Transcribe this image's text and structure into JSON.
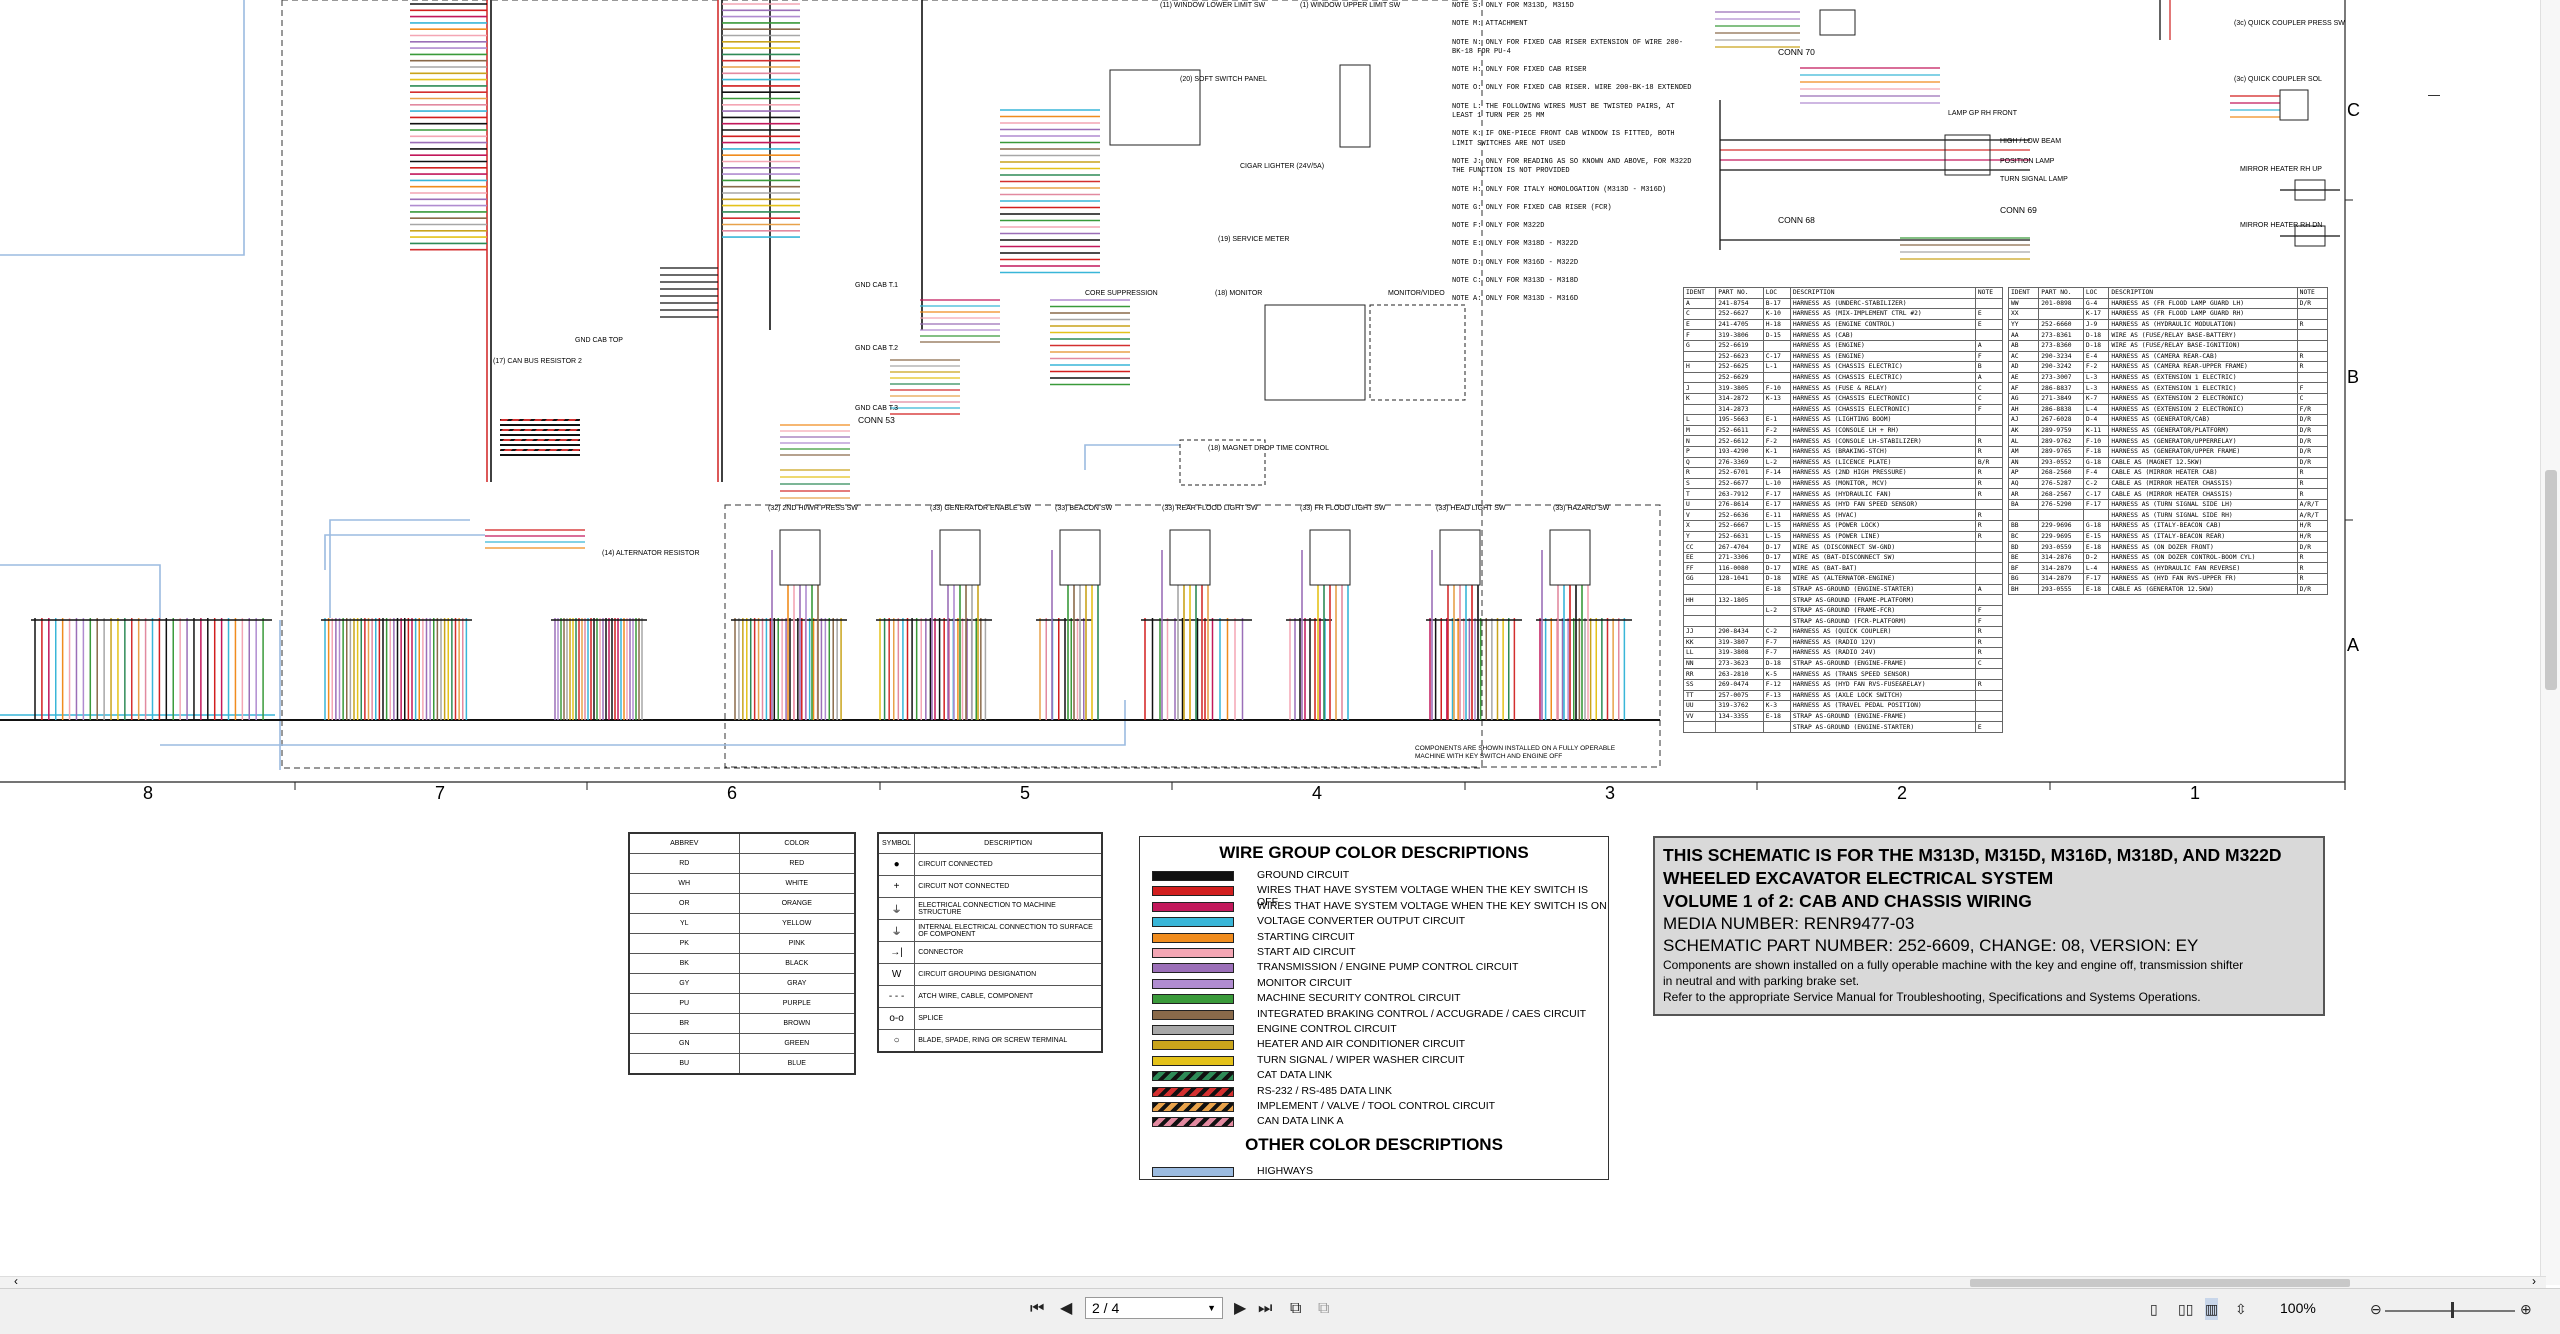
{
  "viewer": {
    "page_value": "2 / 4",
    "zoom": "100%",
    "icons": [
      "first-page-icon",
      "prev-page-icon",
      "next-page-icon",
      "last-page-icon",
      "fit-page-icon",
      "fit-width-icon",
      "single-page-icon",
      "two-page-icon",
      "continuous-icon",
      "scroll-icon",
      "zoom-out-icon",
      "zoom-in-icon"
    ]
  },
  "grid": {
    "rows": [
      "C",
      "B",
      "A"
    ],
    "columns": [
      "8",
      "7",
      "6",
      "5",
      "4",
      "3",
      "2",
      "1"
    ]
  },
  "schematic_labels": {
    "conn70": "CONN 70",
    "conn68": "CONN 68",
    "conn69": "CONN 69",
    "conn53": "CONN 53",
    "c-coupler": "(3c) QUICK COUPLER PRESS SW",
    "c-coupler2": "(3c) QUICK COUPLER SOL",
    "mirror-heater-up": "MIRROR HEATER RH UP",
    "mirror-heater-dn": "MIRROR HEATER RH DN",
    "lamp-rh": "LAMP GP RH FRONT",
    "high-low": "HIGH / LOW BEAM",
    "position-lamp": "POSITION LAMP",
    "turn-signal": "TURN SIGNAL LAMP",
    "soft-switch": "(20) SOFT SWITCH PANEL",
    "monitor": "(18) MONITOR",
    "monitor-video": "MONITOR/VIDEO",
    "cigar-lighter": "CIGAR LIGHTER (24V/5A)",
    "service-meter": "(19) SERVICE METER",
    "core-suppression": "CORE SUPPRESSION",
    "can-bus-resistor": "(17) CAN BUS RESISTOR 2",
    "alternator-resistor": "(14) ALTERNATOR RESISTOR",
    "magnet-drop": "(18) MAGNET DROP TIME CONTROL",
    "window-lower": "(11) WINDOW LOWER LIMIT SW",
    "window-upper": "(1) WINDOW UPPER LIMIT SW",
    "gnd-cab-top": "GND CAB TOP",
    "gnd-cab-1": "GND CAB T.1",
    "gnd-cab-2": "GND CAB T.2",
    "gnd-cab-3": "GND CAB T.3",
    "sw-hiwr": "(32) 2ND HI/WR PRESS SW",
    "sw-gen": "(33) GENERATOR ENABLE SW",
    "sw-beacon": "(33) BEACON SW",
    "sw-rear-flood": "(33) REAR FLOOD LIGHT SW",
    "sw-fr-flood": "(33) FR FLOOD LIGHT SW",
    "sw-head": "(33) HEAD LIGHT SW",
    "sw-hazard": "(33) HAZARD SW",
    "components-note": "COMPONENTS ARE SHOWN INSTALLED ON A FULLY OPERABLE MACHINE WITH KEY SWITCH AND ENGINE OFF",
    "notes": [
      "NOTE S: ONLY FOR M313D, M315D",
      "NOTE M: ATTACHMENT",
      "NOTE N: ONLY FOR FIXED CAB RISER EXTENSION OF WIRE 200-BK-18 FOR PU-4",
      "NOTE H: ONLY FOR FIXED CAB RISER",
      "NOTE O: ONLY FOR FIXED CAB RISER. WIRE 200-BK-18 EXTENDED",
      "NOTE L: THE FOLLOWING WIRES MUST BE TWISTED PAIRS, AT LEAST 1 TURN PER 25 MM",
      "NOTE K: IF ONE-PIECE FRONT CAB WINDOW IS FITTED, BOTH LIMIT SWITCHES ARE NOT USED",
      "NOTE J: ONLY FOR READING AS SO KNOWN AND ABOVE, FOR M322D THE FUNCTION IS NOT PROVIDED",
      "NOTE H: ONLY FOR ITALY HOMOLOGATION (M313D - M316D)",
      "NOTE G: ONLY FOR FIXED CAB RISER (FCR)",
      "NOTE F: ONLY FOR M322D",
      "NOTE E: ONLY FOR M318D - M322D",
      "NOTE D: ONLY FOR M316D - M322D",
      "NOTE C: ONLY FOR M313D - M318D",
      "NOTE A: ONLY FOR M313D - M316D"
    ]
  },
  "abbrev_table": {
    "headers": [
      "ABBREV",
      "COLOR"
    ],
    "rows": [
      [
        "RD",
        "RED"
      ],
      [
        "WH",
        "WHITE"
      ],
      [
        "OR",
        "ORANGE"
      ],
      [
        "YL",
        "YELLOW"
      ],
      [
        "PK",
        "PINK"
      ],
      [
        "BK",
        "BLACK"
      ],
      [
        "GY",
        "GRAY"
      ],
      [
        "PU",
        "PURPLE"
      ],
      [
        "BR",
        "BROWN"
      ],
      [
        "GN",
        "GREEN"
      ],
      [
        "BU",
        "BLUE"
      ]
    ]
  },
  "symbol_table": {
    "headers": [
      "SYMBOL",
      "DESCRIPTION"
    ],
    "rows": [
      [
        "●",
        "CIRCUIT CONNECTED"
      ],
      [
        "+",
        "CIRCUIT NOT CONNECTED"
      ],
      [
        "⏚",
        "ELECTRICAL CONNECTION TO MACHINE STRUCTURE"
      ],
      [
        "⏚",
        "INTERNAL ELECTRICAL CONNECTION TO SURFACE OF COMPONENT"
      ],
      [
        "→|",
        "CONNECTOR"
      ],
      [
        "W",
        "CIRCUIT GROUPING DESIGNATION"
      ],
      [
        "- - -",
        "ATCH WIRE, CABLE, COMPONENT"
      ],
      [
        "o-o",
        "SPLICE"
      ],
      [
        "○",
        "BLADE, SPADE, RING OR SCREW TERMINAL"
      ]
    ]
  },
  "wire_group": {
    "title": "WIRE GROUP COLOR DESCRIPTIONS",
    "other_title": "OTHER COLOR DESCRIPTIONS",
    "items": [
      {
        "color": "#111111",
        "pattern": "solid",
        "label": "GROUND CIRCUIT"
      },
      {
        "color": "#d21f1f",
        "pattern": "solid",
        "label": "WIRES THAT HAVE SYSTEM VOLTAGE WHEN THE KEY SWITCH IS OFF"
      },
      {
        "color": "#c2185b",
        "pattern": "solid",
        "label": "WIRES THAT HAVE SYSTEM VOLTAGE WHEN THE KEY SWITCH IS ON"
      },
      {
        "color": "#39b6d8",
        "pattern": "solid",
        "label": "VOLTAGE CONVERTER OUTPUT CIRCUIT"
      },
      {
        "color": "#f08c1e",
        "pattern": "solid",
        "label": "STARTING CIRCUIT"
      },
      {
        "color": "#f4a6b4",
        "pattern": "solid",
        "label": "START AID CIRCUIT"
      },
      {
        "color": "#9b6fb8",
        "pattern": "solid",
        "label": "TRANSMISSION / ENGINE PUMP CONTROL CIRCUIT"
      },
      {
        "color": "#b08cd0",
        "pattern": "solid",
        "label": "MONITOR CIRCUIT"
      },
      {
        "color": "#3a9a3a",
        "pattern": "solid",
        "label": "MACHINE SECURITY CONTROL CIRCUIT"
      },
      {
        "color": "#8a6a4a",
        "pattern": "solid",
        "label": "INTEGRATED BRAKING CONTROL / ACCUGRADE / CAES CIRCUIT"
      },
      {
        "color": "#a7a7a7",
        "pattern": "solid",
        "label": "ENGINE CONTROL CIRCUIT"
      },
      {
        "color": "#c9a41c",
        "pattern": "solid",
        "label": "HEATER AND AIR CONDITIONER CIRCUIT"
      },
      {
        "color": "#e4c21a",
        "pattern": "solid",
        "label": "TURN SIGNAL / WIPER WASHER CIRCUIT"
      },
      {
        "color": "#2e8b57",
        "pattern": "hatch",
        "label": "CAT DATA LINK"
      },
      {
        "color": "#d32f2f",
        "pattern": "hatch",
        "label": "RS-232 / RS-485 DATA LINK"
      },
      {
        "color": "#e8a24a",
        "pattern": "hatch",
        "label": "IMPLEMENT / VALVE / TOOL CONTROL CIRCUIT"
      },
      {
        "color": "#e28aa0",
        "pattern": "hatch",
        "label": "CAN DATA LINK A"
      }
    ],
    "other_items": [
      {
        "color": "#9bbbe0",
        "pattern": "solid",
        "label": "HIGHWAYS"
      }
    ]
  },
  "info_box": {
    "title1": "THIS SCHEMATIC IS FOR THE M313D, M315D, M316D, M318D, AND M322D",
    "title2": "WHEELED EXCAVATOR ELECTRICAL SYSTEM",
    "title3": "VOLUME 1 of 2: CAB AND CHASSIS WIRING",
    "media": "MEDIA NUMBER: RENR9477-03",
    "part": "SCHEMATIC PART NUMBER: 252-6609, CHANGE: 08, VERSION: EY",
    "desc1": "Components are shown installed on a fully operable machine with the key and engine off, transmission shifter",
    "desc2": "in neutral and with parking brake set.",
    "desc3": "Refer to the appropriate Service Manual for Troubleshooting, Specifications and Systems Operations."
  },
  "parts_left": {
    "headers": [
      "IDENT",
      "PART NO.",
      "LOC",
      "DESCRIPTION",
      "NOTE"
    ],
    "rows": [
      [
        "A",
        "241-8754",
        "B-17",
        "HARNESS AS (UNDERC-STABILIZER)",
        ""
      ],
      [
        "C",
        "252-6627",
        "K-10",
        "HARNESS AS (MIX-IMPLEMENT CTRL #2)",
        "E"
      ],
      [
        "E",
        "241-4705",
        "H-18",
        "HARNESS AS (ENGINE CONTROL)",
        "E"
      ],
      [
        "F",
        "319-3806",
        "D-15",
        "HARNESS AS (CAB)",
        ""
      ],
      [
        "G",
        "252-6619",
        "",
        "HARNESS AS (ENGINE)",
        "A"
      ],
      [
        "",
        "252-6623",
        "C-17",
        "HARNESS AS (ENGINE)",
        "F"
      ],
      [
        "H",
        "252-6625",
        "L-1",
        "HARNESS AS (CHASSIS ELECTRIC)",
        "B"
      ],
      [
        "",
        "252-6629",
        "",
        "HARNESS AS (CHASSIS ELECTRIC)",
        "A"
      ],
      [
        "J",
        "319-3805",
        "F-10",
        "HARNESS AS (FUSE & RELAY)",
        "C"
      ],
      [
        "K",
        "314-2872",
        "K-13",
        "HARNESS AS (CHASSIS ELECTRONIC)",
        "C"
      ],
      [
        "",
        "314-2873",
        "",
        "HARNESS AS (CHASSIS ELECTRONIC)",
        "F"
      ],
      [
        "L",
        "195-5663",
        "E-1",
        "HARNESS AS (LIGHTING BOOM)",
        ""
      ],
      [
        "M",
        "252-6611",
        "F-2",
        "HARNESS AS (CONSOLE LH + RH)",
        ""
      ],
      [
        "N",
        "252-6612",
        "F-2",
        "HARNESS AS (CONSOLE LH-STABILIZER)",
        "R"
      ],
      [
        "P",
        "193-4290",
        "K-1",
        "HARNESS AS (BRAKING-STCH)",
        "R"
      ],
      [
        "Q",
        "276-3369",
        "L-2",
        "HARNESS AS (LICENCE PLATE)",
        "B/R"
      ],
      [
        "R",
        "252-6701",
        "F-14",
        "HARNESS AS (2ND HIGH PRESSURE)",
        "R"
      ],
      [
        "S",
        "252-6677",
        "L-10",
        "HARNESS AS (MONITOR, MCV)",
        "R"
      ],
      [
        "T",
        "263-7912",
        "F-17",
        "HARNESS AS (HYDRAULIC FAN)",
        "R"
      ],
      [
        "U",
        "276-8614",
        "E-17",
        "HARNESS AS (HYD FAN SPEED SENSOR)",
        ""
      ],
      [
        "V",
        "252-6636",
        "E-11",
        "HARNESS AS (HVAC)",
        "R"
      ],
      [
        "X",
        "252-6667",
        "L-15",
        "HARNESS AS (POWER LOCK)",
        "R"
      ],
      [
        "Y",
        "252-6631",
        "L-15",
        "HARNESS AS (POWER LINE)",
        "R"
      ],
      [
        "CC",
        "267-4704",
        "D-17",
        "WIRE AS (DISCONNECT SW-GND)",
        ""
      ],
      [
        "EE",
        "271-3306",
        "D-17",
        "WIRE AS (BAT-DISCONNECT SW)",
        ""
      ],
      [
        "FF",
        "116-0080",
        "D-17",
        "WIRE AS (BAT-BAT)",
        ""
      ],
      [
        "GG",
        "128-1041",
        "D-18",
        "WIRE AS (ALTERNATOR-ENGINE)",
        ""
      ],
      [
        "",
        "",
        "E-18",
        "STRAP AS-GROUND (ENGINE-STARTER)",
        "A"
      ],
      [
        "HH",
        "132-1805",
        "",
        "STRAP AS-GROUND (FRAME-PLATFORM)",
        ""
      ],
      [
        "",
        "",
        "L-2",
        "STRAP AS-GROUND (FRAME-FCR)",
        "F"
      ],
      [
        "",
        "",
        "",
        "STRAP AS-GROUND (FCR-PLATFORM)",
        "F"
      ],
      [
        "JJ",
        "290-8434",
        "C-2",
        "HARNESS AS (QUICK COUPLER)",
        "R"
      ],
      [
        "KK",
        "319-3807",
        "F-7",
        "HARNESS AS (RADIO 12V)",
        "R"
      ],
      [
        "LL",
        "319-3808",
        "F-7",
        "HARNESS AS (RADIO 24V)",
        "R"
      ],
      [
        "NN",
        "273-3623",
        "D-18",
        "STRAP AS-GROUND (ENGINE-FRAME)",
        "C"
      ],
      [
        "RR",
        "263-2810",
        "K-5",
        "HARNESS AS (TRANS SPEED SENSOR)",
        ""
      ],
      [
        "SS",
        "269-0474",
        "F-12",
        "HARNESS AS (HYD FAN RVS-FUSE&RELAY)",
        "R"
      ],
      [
        "TT",
        "257-0075",
        "F-13",
        "HARNESS AS (AXLE LOCK SWITCH)",
        ""
      ],
      [
        "UU",
        "319-3762",
        "K-3",
        "HARNESS AS (TRAVEL PEDAL POSITION)",
        ""
      ],
      [
        "VV",
        "134-3355",
        "E-18",
        "STRAP AS-GROUND (ENGINE-FRAME)",
        ""
      ],
      [
        "",
        "",
        "",
        "STRAP AS-GROUND (ENGINE-STARTER)",
        "E"
      ]
    ]
  },
  "parts_right": {
    "headers": [
      "IDENT",
      "PART NO.",
      "LOC",
      "DESCRIPTION",
      "NOTE"
    ],
    "rows": [
      [
        "WW",
        "201-0898",
        "G-4",
        "HARNESS AS (FR FLOOD LAMP GUARD LH)",
        "D/R"
      ],
      [
        "XX",
        "",
        "K-17",
        "HARNESS AS (FR FLOOD LAMP GUARD RH)",
        ""
      ],
      [
        "YY",
        "252-6660",
        "J-9",
        "HARNESS AS (HYDRAULIC MODULATION)",
        "R"
      ],
      [
        "AA",
        "273-8361",
        "D-18",
        "WIRE AS (FUSE/RELAY BASE-BATTERY)",
        ""
      ],
      [
        "AB",
        "273-8360",
        "D-18",
        "WIRE AS (FUSE/RELAY BASE-IGNITION)",
        ""
      ],
      [
        "AC",
        "290-3234",
        "E-4",
        "HARNESS AS (CAMERA REAR-CAB)",
        "R"
      ],
      [
        "AD",
        "290-3242",
        "F-2",
        "HARNESS AS (CAMERA REAR-UPPER FRAME)",
        "R"
      ],
      [
        "AE",
        "273-3007",
        "L-3",
        "HARNESS AS (EXTENSION 1 ELECTRIC)",
        ""
      ],
      [
        "AF",
        "286-8837",
        "L-3",
        "HARNESS AS (EXTENSION 1 ELECTRIC)",
        "F"
      ],
      [
        "AG",
        "271-3849",
        "K-7",
        "HARNESS AS (EXTENSION 2 ELECTRONIC)",
        "C"
      ],
      [
        "AH",
        "286-8838",
        "L-4",
        "HARNESS AS (EXTENSION 2 ELECTRONIC)",
        "F/R"
      ],
      [
        "AJ",
        "267-6028",
        "D-4",
        "HARNESS AS (GENERATOR/CAB)",
        "D/R"
      ],
      [
        "AK",
        "289-9759",
        "K-11",
        "HARNESS AS (GENERATOR/PLATFORM)",
        "D/R"
      ],
      [
        "AL",
        "289-9762",
        "F-10",
        "HARNESS AS (GENERATOR/UPPERRELAY)",
        "D/R"
      ],
      [
        "AM",
        "289-9765",
        "F-18",
        "HARNESS AS (GENERATOR/UPPER FRAME)",
        "D/R"
      ],
      [
        "AN",
        "293-0552",
        "G-18",
        "CABLE AS (MAGNET 12.5KW)",
        "D/R"
      ],
      [
        "AP",
        "268-2560",
        "F-4",
        "CABLE AS (MIRROR HEATER CAB)",
        "R"
      ],
      [
        "AQ",
        "276-5287",
        "C-2",
        "CABLE AS (MIRROR HEATER CHASSIS)",
        "R"
      ],
      [
        "AR",
        "268-2567",
        "C-17",
        "CABLE AS (MIRROR HEATER CHASSIS)",
        "R"
      ],
      [
        "BA",
        "276-5290",
        "F-17",
        "HARNESS AS (TURN SIGNAL SIDE LH)",
        "A/R/T"
      ],
      [
        "",
        "",
        "",
        "HARNESS AS (TURN SIGNAL SIDE RH)",
        "A/R/T"
      ],
      [
        "BB",
        "229-9696",
        "G-18",
        "HARNESS AS (ITALY-BEACON CAB)",
        "H/R"
      ],
      [
        "BC",
        "229-9695",
        "E-15",
        "HARNESS AS (ITALY-BEACON REAR)",
        "H/R"
      ],
      [
        "BD",
        "293-0559",
        "E-18",
        "HARNESS AS (ON DOZER FRONT)",
        "D/R"
      ],
      [
        "BE",
        "314-2876",
        "D-2",
        "HARNESS AS (ON DOZER CONTROL-BOOM CYL)",
        "R"
      ],
      [
        "BF",
        "314-2879",
        "L-4",
        "HARNESS AS (HYDRAULIC FAN REVERSE)",
        "R"
      ],
      [
        "BG",
        "314-2879",
        "F-17",
        "HARNESS AS (HYD FAN RVS-UPPER FR)",
        "R"
      ],
      [
        "BH",
        "293-0555",
        "E-18",
        "CABLE AS (GENERATOR 12.5KW)",
        "D/R"
      ]
    ]
  }
}
